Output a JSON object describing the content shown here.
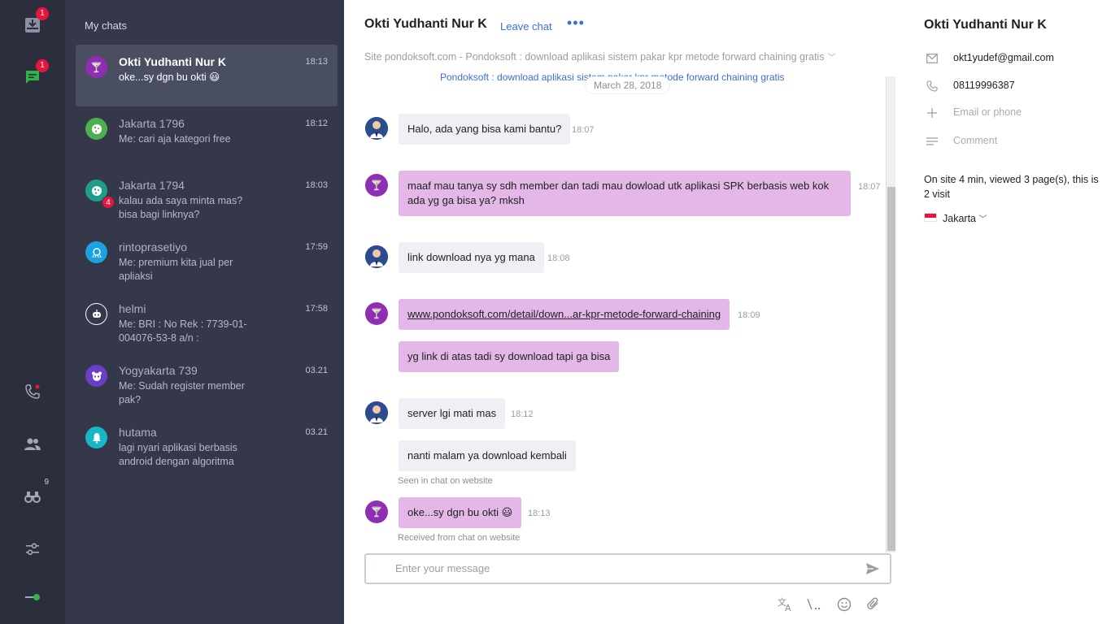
{
  "rail": {
    "inbox_badge": "1",
    "chats_badge": "1",
    "binoculars_count": "9",
    "colors": {
      "accent_green": "#2fb34a",
      "badge_red": "#e8163c",
      "rail_bg": "#2b2e3c"
    }
  },
  "chatlist": {
    "title": "My chats",
    "items": [
      {
        "name": "Okti Yudhanti Nur K",
        "time": "18:13",
        "preview": "oke...sy dgn bu okti 😃",
        "avatar_icon": "cocktail-icon",
        "avatar_color": "#8e2eb3",
        "active": true
      },
      {
        "name": "Jakarta 1796",
        "time": "18:12",
        "preview": "Me: cari aja kategori free",
        "avatar_icon": "cookie-icon",
        "avatar_color": "#4caf50"
      },
      {
        "name": "Jakarta 1794",
        "time": "18:03",
        "preview": "kalau ada saya minta mas? bisa bagi linknya?",
        "avatar_icon": "cookie-icon",
        "avatar_color": "#1e9e8a",
        "unread": "4"
      },
      {
        "name": "rintoprasetiyo",
        "time": "17:59",
        "preview": "Me: premium kita jual per apliaksi",
        "avatar_icon": "octopus-icon",
        "avatar_color": "#1da1e2"
      },
      {
        "name": "helmi",
        "time": "17:58",
        "preview": "Me: BRI : No Rek : 7739-01-004076-53-8 a/n :",
        "avatar_icon": "robot-icon",
        "avatar_color": "#343848"
      },
      {
        "name": "Yogyakarta 739",
        "time": "03.21",
        "preview": "Me: Sudah register member pak?",
        "avatar_icon": "panda-icon",
        "avatar_color": "#6a3fc7"
      },
      {
        "name": "hutama",
        "time": "03.21",
        "preview": "lagi nyari aplikasi berbasis android dengan algoritma",
        "avatar_icon": "bell-icon",
        "avatar_color": "#15b8c9"
      }
    ]
  },
  "main": {
    "title": "Okti Yudhanti Nur K",
    "leave_chat": "Leave chat",
    "more": "•••",
    "site_line": "Site pondoksoft.com - Pondoksoft : download aplikasi sistem pakar kpr metode forward chaining gratis",
    "top_link": "Pondoksoft : download aplikasi sistem pakar kpr metode forward chaining gratis",
    "date_chip": "March 28, 2018",
    "messages": [
      {
        "from": "agent",
        "text": "Halo, ada yang bisa kami bantu?",
        "time": "18:07"
      },
      {
        "from": "visitor",
        "text": "maaf mau tanya sy sdh member dan tadi mau dowload utk aplikasi SPK berbasis web kok ada yg ga bisa ya? mksh",
        "time": "18:07"
      },
      {
        "from": "agent",
        "text": "link download nya yg mana",
        "time": "18:08"
      },
      {
        "from": "visitor",
        "text": "www.pondoksoft.com/detail/down...ar-kpr-metode-forward-chaining",
        "time": "18:09"
      },
      {
        "from": "visitor",
        "text": "yg link di atas tadi sy download tapi ga bisa",
        "time": ""
      },
      {
        "from": "agent",
        "text": "server lgi mati mas",
        "time": "18:12"
      },
      {
        "from": "agent",
        "text": "nanti malam ya download kembali",
        "time": ""
      },
      {
        "from": "visitor",
        "text": "oke...sy dgn bu okti 😃",
        "time": "18:13"
      }
    ],
    "seen_meta": "Seen in chat on website",
    "received_meta": "Received from chat on website",
    "composer": {
      "placeholder": "Enter your message"
    }
  },
  "details": {
    "name": "Okti Yudhanti Nur K",
    "email": "okt1yudef@gmail.com",
    "phone": "08119996387",
    "add_contact_placeholder": "Email or phone",
    "comment_placeholder": "Comment",
    "visit_info": "On site 4 min, viewed 3 page(s), this is 2 visit",
    "location": "Jakarta"
  }
}
